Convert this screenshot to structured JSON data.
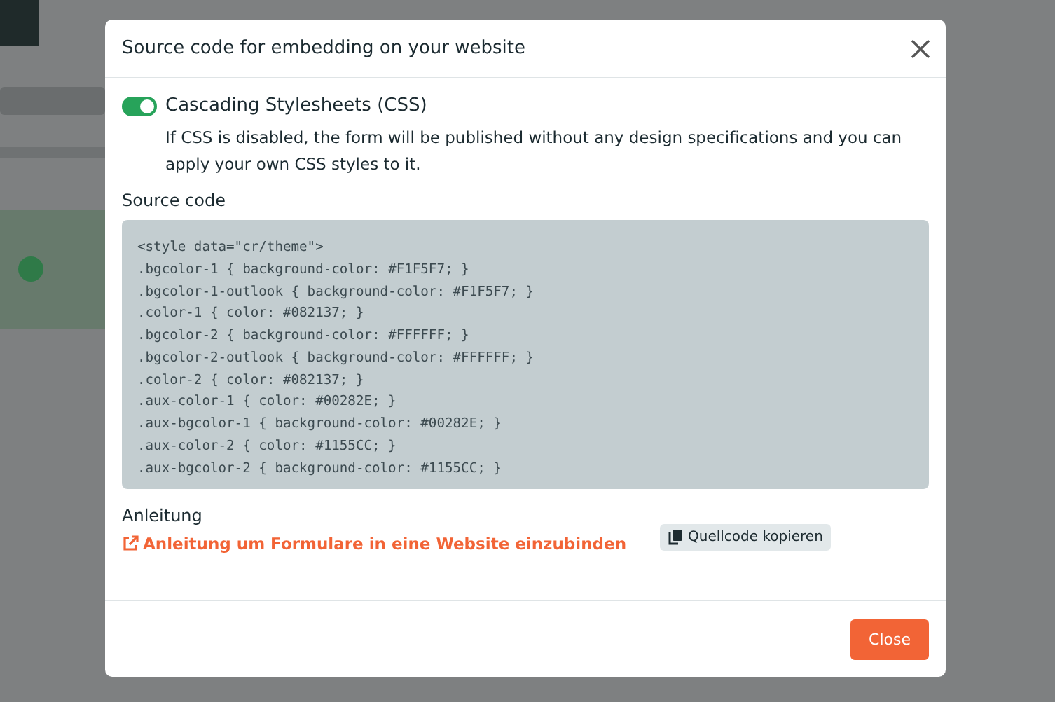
{
  "dialog": {
    "title": "Source code for embedding on your website",
    "css_option": {
      "label": "Cascading Stylesheets (CSS)",
      "on": true,
      "description": "If CSS is disabled, the form will be published without any design specifications and you can apply your own CSS styles to it."
    },
    "source_code": {
      "heading": "Source code",
      "lines": [
        "<style data=\"cr/theme\">",
        ".bgcolor-1 { background-color: #F1F5F7; }",
        ".bgcolor-1-outlook { background-color: #F1F5F7; }",
        ".color-1 { color: #082137; }",
        ".bgcolor-2 { background-color: #FFFFFF; }",
        ".bgcolor-2-outlook { background-color: #FFFFFF; }",
        ".color-2 { color: #082137; }",
        ".aux-color-1 { color: #00282E; }",
        ".aux-bgcolor-1 { background-color: #00282E; }",
        ".aux-color-2 { color: #1155CC; }",
        ".aux-bgcolor-2 { background-color: #1155CC; }"
      ]
    },
    "instructions": {
      "heading": "Anleitung",
      "link": "Anleitung um Formulare in eine Website einzubinden"
    },
    "copy_button": "Quellcode kopieren",
    "close_button": "Close"
  }
}
